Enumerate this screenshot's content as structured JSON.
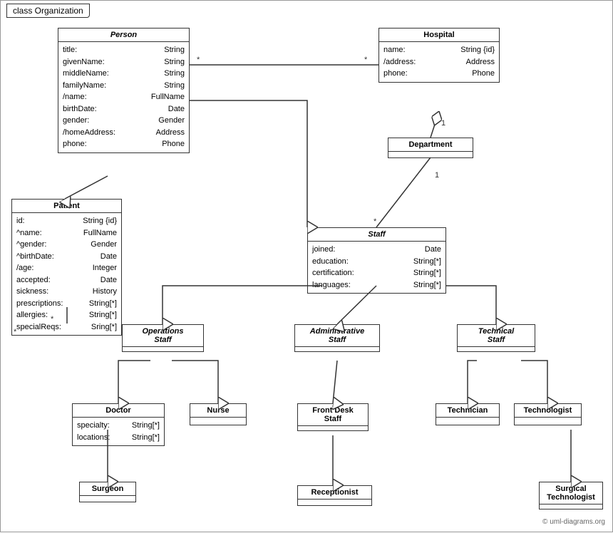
{
  "title": "class Organization",
  "classes": {
    "person": {
      "name": "Person",
      "italic": true,
      "attrs": [
        {
          "name": "title:",
          "type": "String"
        },
        {
          "name": "givenName:",
          "type": "String"
        },
        {
          "name": "middleName:",
          "type": "String"
        },
        {
          "name": "familyName:",
          "type": "String"
        },
        {
          "name": "/name:",
          "type": "FullName"
        },
        {
          "name": "birthDate:",
          "type": "Date"
        },
        {
          "name": "gender:",
          "type": "Gender"
        },
        {
          "name": "/homeAddress:",
          "type": "Address"
        },
        {
          "name": "phone:",
          "type": "Phone"
        }
      ]
    },
    "hospital": {
      "name": "Hospital",
      "italic": false,
      "attrs": [
        {
          "name": "name:",
          "type": "String {id}"
        },
        {
          "name": "/address:",
          "type": "Address"
        },
        {
          "name": "phone:",
          "type": "Phone"
        }
      ]
    },
    "department": {
      "name": "Department",
      "italic": false,
      "attrs": []
    },
    "staff": {
      "name": "Staff",
      "italic": true,
      "attrs": [
        {
          "name": "joined:",
          "type": "Date"
        },
        {
          "name": "education:",
          "type": "String[*]"
        },
        {
          "name": "certification:",
          "type": "String[*]"
        },
        {
          "name": "languages:",
          "type": "String[*]"
        }
      ]
    },
    "patient": {
      "name": "Patient",
      "italic": false,
      "attrs": [
        {
          "name": "id:",
          "type": "String {id}"
        },
        {
          "name": "^name:",
          "type": "FullName"
        },
        {
          "name": "^gender:",
          "type": "Gender"
        },
        {
          "name": "^birthDate:",
          "type": "Date"
        },
        {
          "name": "/age:",
          "type": "Integer"
        },
        {
          "name": "accepted:",
          "type": "Date"
        },
        {
          "name": "sickness:",
          "type": "History"
        },
        {
          "name": "prescriptions:",
          "type": "String[*]"
        },
        {
          "name": "allergies:",
          "type": "String[*]"
        },
        {
          "name": "specialReqs:",
          "type": "Sring[*]"
        }
      ]
    },
    "operations_staff": {
      "name": "Operations\nStaff",
      "italic": true,
      "attrs": []
    },
    "administrative_staff": {
      "name": "Administrative\nStaff",
      "italic": true,
      "attrs": []
    },
    "technical_staff": {
      "name": "Technical\nStaff",
      "italic": true,
      "attrs": []
    },
    "doctor": {
      "name": "Doctor",
      "italic": false,
      "attrs": [
        {
          "name": "specialty:",
          "type": "String[*]"
        },
        {
          "name": "locations:",
          "type": "String[*]"
        }
      ]
    },
    "nurse": {
      "name": "Nurse",
      "italic": false,
      "attrs": []
    },
    "front_desk_staff": {
      "name": "Front Desk\nStaff",
      "italic": false,
      "attrs": []
    },
    "technician": {
      "name": "Technician",
      "italic": false,
      "attrs": []
    },
    "technologist": {
      "name": "Technologist",
      "italic": false,
      "attrs": []
    },
    "surgeon": {
      "name": "Surgeon",
      "italic": false,
      "attrs": []
    },
    "receptionist": {
      "name": "Receptionist",
      "italic": false,
      "attrs": []
    },
    "surgical_technologist": {
      "name": "Surgical\nTechnologist",
      "italic": false,
      "attrs": []
    }
  },
  "watermark": "© uml-diagrams.org"
}
